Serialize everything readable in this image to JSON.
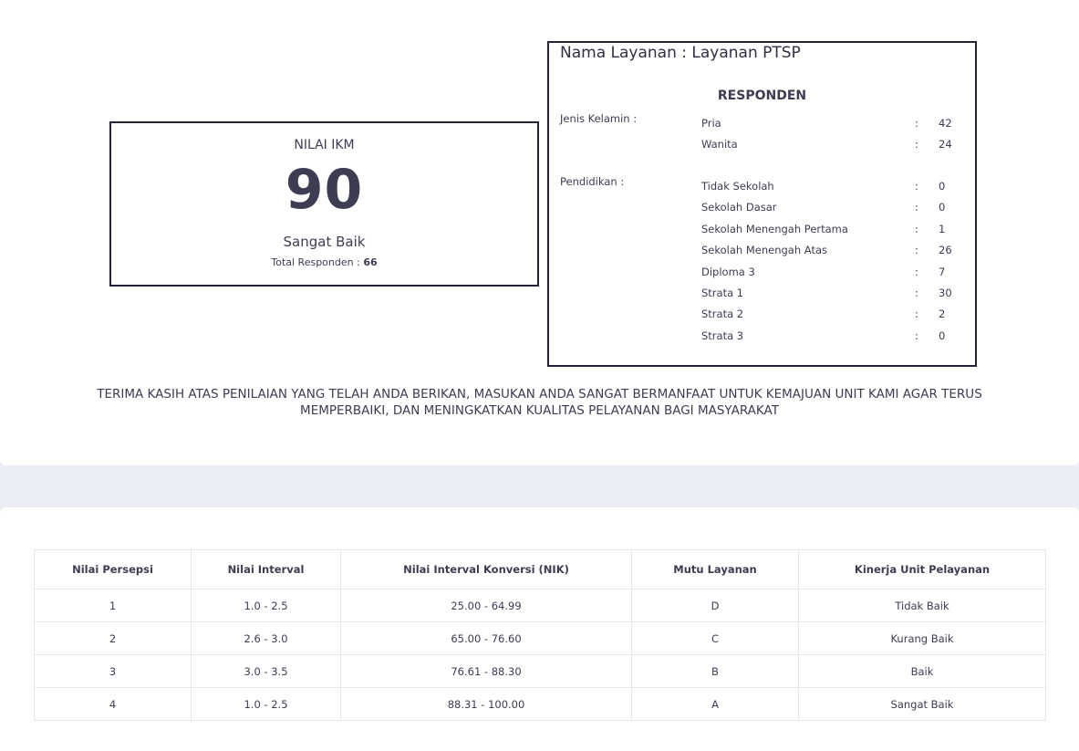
{
  "ikm": {
    "label": "NILAI IKM",
    "value": "90",
    "mutu": "Sangat Baik",
    "total_label": "Total Responden :",
    "total_value": "66"
  },
  "responden": {
    "service_prefix": "Nama Layanan :",
    "service_name": "Layanan PTSP",
    "title": "RESPONDEN",
    "gender_label": "Jenis Kelamin :",
    "gender": [
      {
        "name": "Pria",
        "value": "42"
      },
      {
        "name": "Wanita",
        "value": "24"
      }
    ],
    "education_label": "Pendidikan :",
    "education": [
      {
        "name": "Tidak Sekolah",
        "value": "0"
      },
      {
        "name": "Sekolah Dasar",
        "value": "0"
      },
      {
        "name": "Sekolah Menengah Pertama",
        "value": "1"
      },
      {
        "name": "Sekolah Menengah Atas",
        "value": "26"
      },
      {
        "name": "Diploma 3",
        "value": "7"
      },
      {
        "name": "Strata 1",
        "value": "30"
      },
      {
        "name": "Strata 2",
        "value": "2"
      },
      {
        "name": "Strata 3",
        "value": "0"
      }
    ]
  },
  "thanks_line1": "TERIMA KASIH ATAS PENILAIAN YANG TELAH ANDA BERIKAN, MASUKAN ANDA SANGAT BERMANFAAT UNTUK KEMAJUAN UNIT KAMI AGAR TERUS",
  "thanks_line2": "MEMPERBAIKI, DAN MENINGKATKAN KUALITAS PELAYANAN BAGI MASYARAKAT",
  "table": {
    "headers": [
      "Nilai Persepsi",
      "Nilai Interval",
      "Nilai Interval Konversi (NIK)",
      "Mutu Layanan",
      "Kinerja Unit Pelayanan"
    ],
    "rows": [
      [
        "1",
        "1.0 - 2.5",
        "25.00 - 64.99",
        "D",
        "Tidak Baik"
      ],
      [
        "2",
        "2.6 - 3.0",
        "65.00 - 76.60",
        "C",
        "Kurang Baik"
      ],
      [
        "3",
        "3.0 - 3.5",
        "76.61 - 88.30",
        "B",
        "Baik"
      ],
      [
        "4",
        "1.0 - 2.5",
        "88.31 - 100.00",
        "A",
        "Sangat Baik"
      ]
    ]
  }
}
